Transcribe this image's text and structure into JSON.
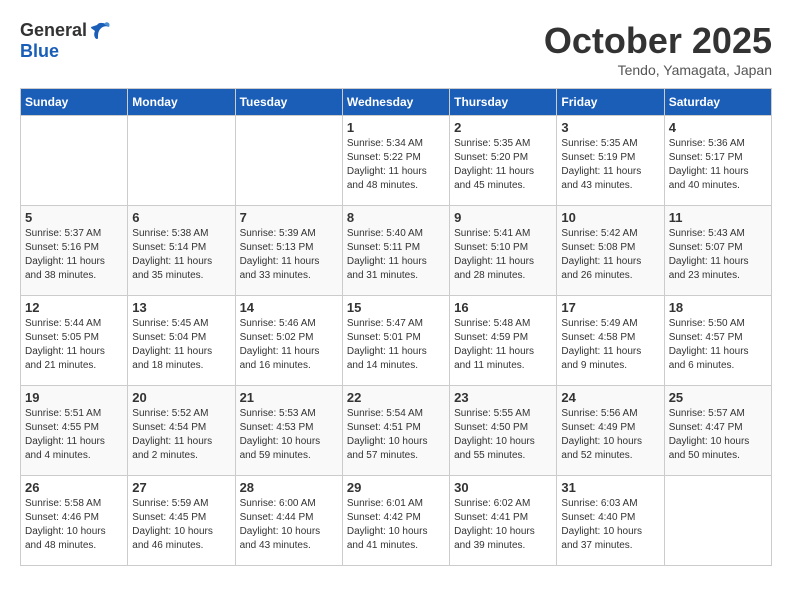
{
  "header": {
    "logo_general": "General",
    "logo_blue": "Blue",
    "month": "October 2025",
    "location": "Tendo, Yamagata, Japan"
  },
  "days_of_week": [
    "Sunday",
    "Monday",
    "Tuesday",
    "Wednesday",
    "Thursday",
    "Friday",
    "Saturday"
  ],
  "weeks": [
    [
      {
        "day": "",
        "info": ""
      },
      {
        "day": "",
        "info": ""
      },
      {
        "day": "",
        "info": ""
      },
      {
        "day": "1",
        "info": "Sunrise: 5:34 AM\nSunset: 5:22 PM\nDaylight: 11 hours\nand 48 minutes."
      },
      {
        "day": "2",
        "info": "Sunrise: 5:35 AM\nSunset: 5:20 PM\nDaylight: 11 hours\nand 45 minutes."
      },
      {
        "day": "3",
        "info": "Sunrise: 5:35 AM\nSunset: 5:19 PM\nDaylight: 11 hours\nand 43 minutes."
      },
      {
        "day": "4",
        "info": "Sunrise: 5:36 AM\nSunset: 5:17 PM\nDaylight: 11 hours\nand 40 minutes."
      }
    ],
    [
      {
        "day": "5",
        "info": "Sunrise: 5:37 AM\nSunset: 5:16 PM\nDaylight: 11 hours\nand 38 minutes."
      },
      {
        "day": "6",
        "info": "Sunrise: 5:38 AM\nSunset: 5:14 PM\nDaylight: 11 hours\nand 35 minutes."
      },
      {
        "day": "7",
        "info": "Sunrise: 5:39 AM\nSunset: 5:13 PM\nDaylight: 11 hours\nand 33 minutes."
      },
      {
        "day": "8",
        "info": "Sunrise: 5:40 AM\nSunset: 5:11 PM\nDaylight: 11 hours\nand 31 minutes."
      },
      {
        "day": "9",
        "info": "Sunrise: 5:41 AM\nSunset: 5:10 PM\nDaylight: 11 hours\nand 28 minutes."
      },
      {
        "day": "10",
        "info": "Sunrise: 5:42 AM\nSunset: 5:08 PM\nDaylight: 11 hours\nand 26 minutes."
      },
      {
        "day": "11",
        "info": "Sunrise: 5:43 AM\nSunset: 5:07 PM\nDaylight: 11 hours\nand 23 minutes."
      }
    ],
    [
      {
        "day": "12",
        "info": "Sunrise: 5:44 AM\nSunset: 5:05 PM\nDaylight: 11 hours\nand 21 minutes."
      },
      {
        "day": "13",
        "info": "Sunrise: 5:45 AM\nSunset: 5:04 PM\nDaylight: 11 hours\nand 18 minutes."
      },
      {
        "day": "14",
        "info": "Sunrise: 5:46 AM\nSunset: 5:02 PM\nDaylight: 11 hours\nand 16 minutes."
      },
      {
        "day": "15",
        "info": "Sunrise: 5:47 AM\nSunset: 5:01 PM\nDaylight: 11 hours\nand 14 minutes."
      },
      {
        "day": "16",
        "info": "Sunrise: 5:48 AM\nSunset: 4:59 PM\nDaylight: 11 hours\nand 11 minutes."
      },
      {
        "day": "17",
        "info": "Sunrise: 5:49 AM\nSunset: 4:58 PM\nDaylight: 11 hours\nand 9 minutes."
      },
      {
        "day": "18",
        "info": "Sunrise: 5:50 AM\nSunset: 4:57 PM\nDaylight: 11 hours\nand 6 minutes."
      }
    ],
    [
      {
        "day": "19",
        "info": "Sunrise: 5:51 AM\nSunset: 4:55 PM\nDaylight: 11 hours\nand 4 minutes."
      },
      {
        "day": "20",
        "info": "Sunrise: 5:52 AM\nSunset: 4:54 PM\nDaylight: 11 hours\nand 2 minutes."
      },
      {
        "day": "21",
        "info": "Sunrise: 5:53 AM\nSunset: 4:53 PM\nDaylight: 10 hours\nand 59 minutes."
      },
      {
        "day": "22",
        "info": "Sunrise: 5:54 AM\nSunset: 4:51 PM\nDaylight: 10 hours\nand 57 minutes."
      },
      {
        "day": "23",
        "info": "Sunrise: 5:55 AM\nSunset: 4:50 PM\nDaylight: 10 hours\nand 55 minutes."
      },
      {
        "day": "24",
        "info": "Sunrise: 5:56 AM\nSunset: 4:49 PM\nDaylight: 10 hours\nand 52 minutes."
      },
      {
        "day": "25",
        "info": "Sunrise: 5:57 AM\nSunset: 4:47 PM\nDaylight: 10 hours\nand 50 minutes."
      }
    ],
    [
      {
        "day": "26",
        "info": "Sunrise: 5:58 AM\nSunset: 4:46 PM\nDaylight: 10 hours\nand 48 minutes."
      },
      {
        "day": "27",
        "info": "Sunrise: 5:59 AM\nSunset: 4:45 PM\nDaylight: 10 hours\nand 46 minutes."
      },
      {
        "day": "28",
        "info": "Sunrise: 6:00 AM\nSunset: 4:44 PM\nDaylight: 10 hours\nand 43 minutes."
      },
      {
        "day": "29",
        "info": "Sunrise: 6:01 AM\nSunset: 4:42 PM\nDaylight: 10 hours\nand 41 minutes."
      },
      {
        "day": "30",
        "info": "Sunrise: 6:02 AM\nSunset: 4:41 PM\nDaylight: 10 hours\nand 39 minutes."
      },
      {
        "day": "31",
        "info": "Sunrise: 6:03 AM\nSunset: 4:40 PM\nDaylight: 10 hours\nand 37 minutes."
      },
      {
        "day": "",
        "info": ""
      }
    ]
  ]
}
